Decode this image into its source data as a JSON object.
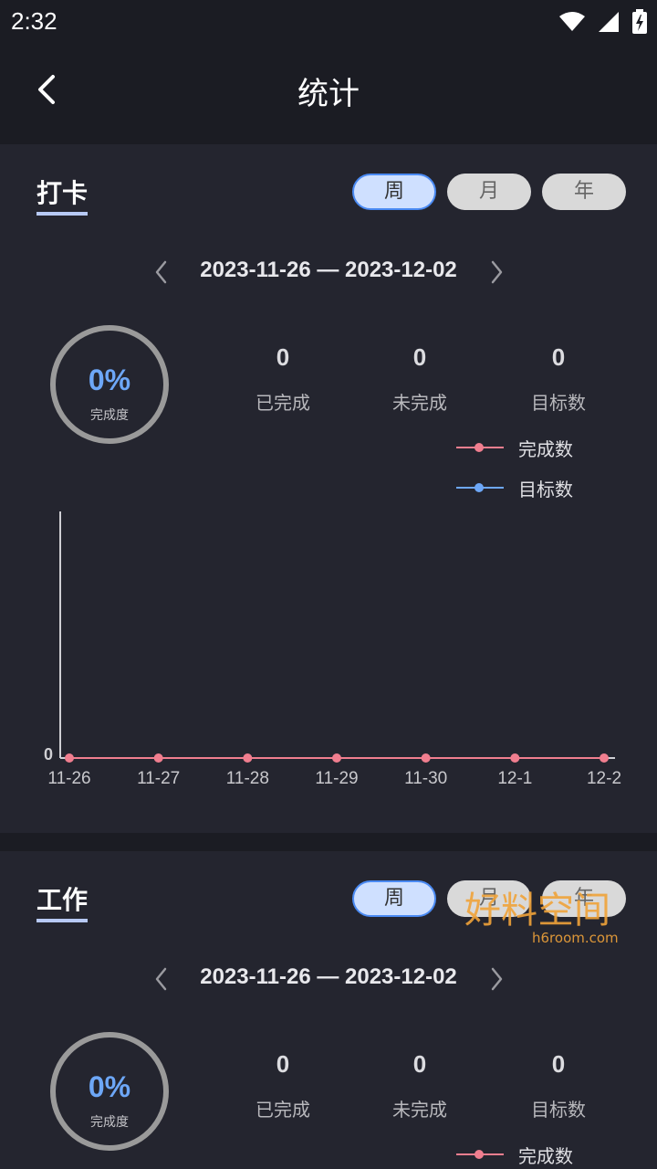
{
  "status_bar": {
    "time": "2:32"
  },
  "appbar": {
    "title": "统计"
  },
  "sections": [
    {
      "title": "打卡",
      "periods": [
        "周",
        "月",
        "年"
      ],
      "active_period": "周",
      "date_range": "2023-11-26 — 2023-12-02",
      "completion_pct": "0%",
      "completion_label": "完成度",
      "stats": [
        {
          "value": "0",
          "label": "已完成"
        },
        {
          "value": "0",
          "label": "未完成"
        },
        {
          "value": "0",
          "label": "目标数"
        }
      ],
      "legend": [
        {
          "label": "完成数",
          "color": "#f07e8f"
        },
        {
          "label": "目标数",
          "color": "#6da7f7"
        }
      ]
    },
    {
      "title": "工作",
      "periods": [
        "周",
        "月",
        "年"
      ],
      "active_period": "周",
      "date_range": "2023-11-26 — 2023-12-02",
      "completion_pct": "0%",
      "completion_label": "完成度",
      "stats": [
        {
          "value": "0",
          "label": "已完成"
        },
        {
          "value": "0",
          "label": "未完成"
        },
        {
          "value": "0",
          "label": "目标数"
        }
      ],
      "legend": [
        {
          "label": "完成数",
          "color": "#f07e8f"
        }
      ]
    }
  ],
  "chart_data": {
    "type": "line",
    "x": [
      "11-26",
      "11-27",
      "11-28",
      "11-29",
      "11-30",
      "12-1",
      "12-2"
    ],
    "series": [
      {
        "name": "完成数",
        "values": [
          0,
          0,
          0,
          0,
          0,
          0,
          0
        ],
        "color": "#f07e8f"
      }
    ],
    "y_ticks": [
      "0"
    ],
    "ylim": [
      0,
      1
    ]
  },
  "watermark": {
    "text": "好料空间",
    "url": "h6room.com"
  }
}
